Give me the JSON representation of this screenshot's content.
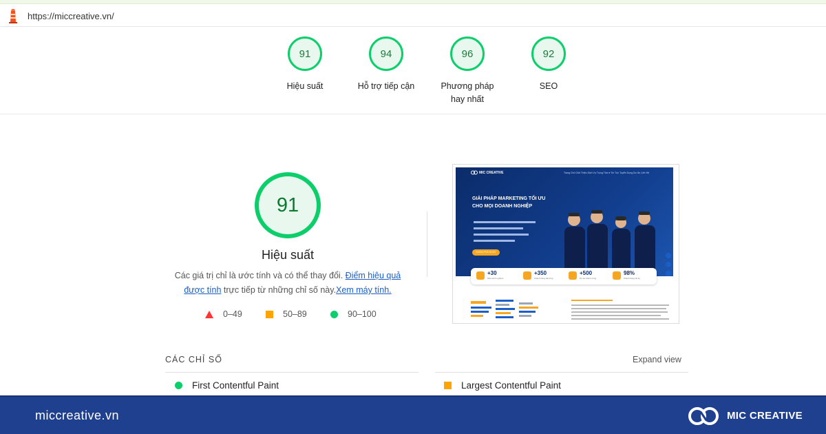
{
  "address_bar": {
    "url": "https://miccreative.vn/"
  },
  "category_gauges": [
    {
      "score": "91",
      "label": "Hiệu suất"
    },
    {
      "score": "94",
      "label": "Hỗ trợ tiếp cận"
    },
    {
      "score": "96",
      "label": "Phương pháp hay nhất"
    },
    {
      "score": "92",
      "label": "SEO"
    }
  ],
  "performance": {
    "score": "91",
    "title": "Hiệu suất",
    "desc_prefix": "Các giá trị chỉ là ước tính và có thể thay đổi. ",
    "desc_link1": "Điểm hiệu quả được tính",
    "desc_middle": " trực tiếp từ những chỉ số này.",
    "desc_link2": "Xem máy tính."
  },
  "legend": [
    {
      "range": "0–49",
      "color": "#ff3333"
    },
    {
      "range": "50–89",
      "color": "#ffa400"
    },
    {
      "range": "90–100",
      "color": "#0cce6b"
    }
  ],
  "screenshot_preview": {
    "brand": "MIC CREATIVE",
    "menu": "Trang Chủ   Giới Thiệu   Dịch Vụ Trọng Tâm ▾   Tin Tức   Tuyển Dụng   Dự Án   Liên Hệ",
    "headline_line1": "GIẢI PHÁP MARKETING TỐI ƯU",
    "headline_line2": "CHO MỌI DOANH NGHIỆP",
    "button": "KHÁM PHÁ NGAY",
    "stats": [
      {
        "value": "+30",
        "caption": "Năm kinh nghiệm"
      },
      {
        "value": "+350",
        "caption": "Khách hàng hài lòng"
      },
      {
        "value": "+500",
        "caption": "Dự án thành công"
      },
      {
        "value": "98%",
        "caption": "Khách hàng tái ký"
      }
    ]
  },
  "metrics": {
    "section_title": "CÁC CHỈ SỐ",
    "expand_label": "Expand view",
    "items": [
      {
        "label": "First Contentful Paint",
        "status": "good"
      },
      {
        "label": "Largest Contentful Paint",
        "status": "average"
      }
    ]
  },
  "footer": {
    "url": "miccreative.vn",
    "brand": "MIC CREATIVE"
  },
  "colors": {
    "pass": "#0cce6b",
    "average": "#ffa400",
    "fail": "#ff3333",
    "footer_bg": "#1f3f8f"
  }
}
